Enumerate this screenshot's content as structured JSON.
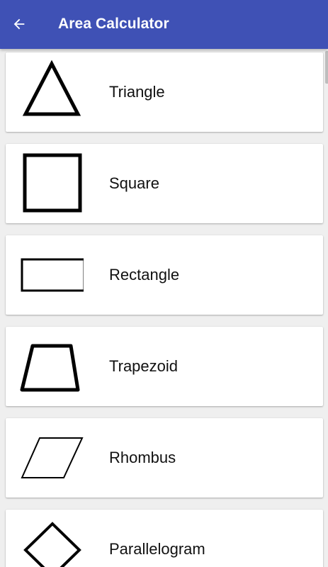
{
  "appbar": {
    "title": "Area Calculator",
    "back_icon": "arrow-left-icon",
    "background": "#3f51b5"
  },
  "shapes": [
    {
      "label": "Triangle",
      "icon": "triangle-icon"
    },
    {
      "label": "Square",
      "icon": "square-icon"
    },
    {
      "label": "Rectangle",
      "icon": "rectangle-icon"
    },
    {
      "label": "Trapezoid",
      "icon": "trapezoid-icon"
    },
    {
      "label": "Rhombus",
      "icon": "rhombus-icon"
    },
    {
      "label": "Parallelogram",
      "icon": "parallelogram-icon"
    }
  ]
}
